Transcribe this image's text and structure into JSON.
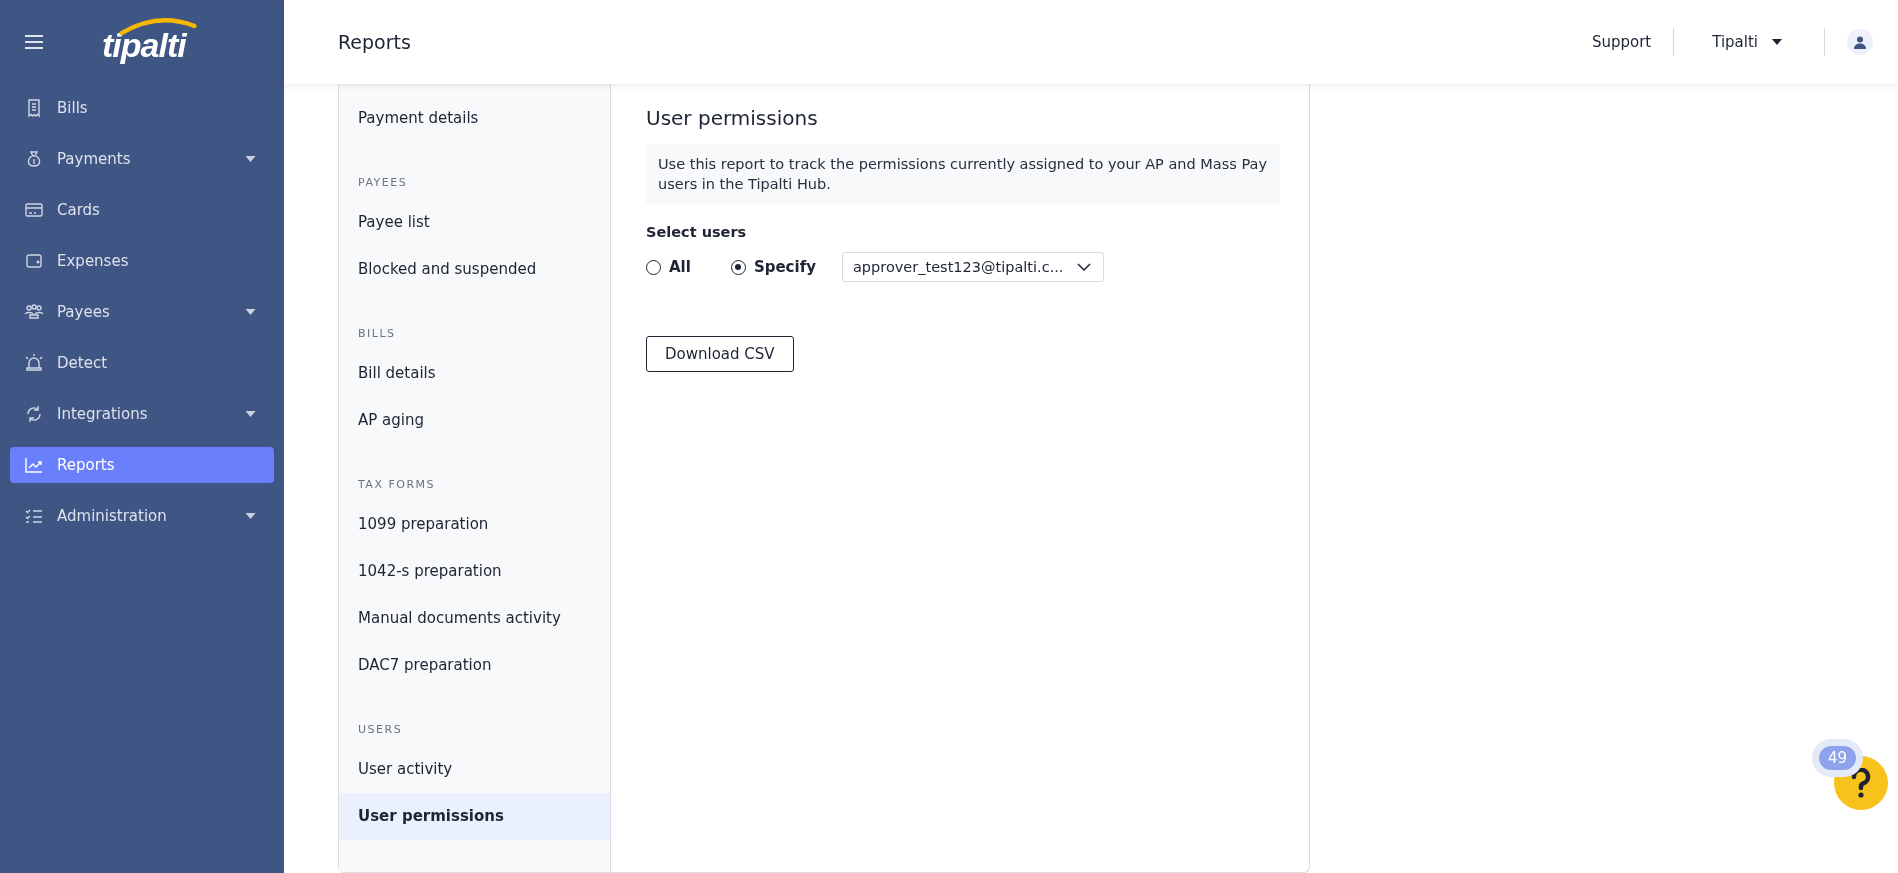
{
  "sidebar": {
    "logo": "tipalti",
    "items": [
      {
        "label": "Bills",
        "has_dropdown": false,
        "selected": false
      },
      {
        "label": "Payments",
        "has_dropdown": true,
        "selected": false
      },
      {
        "label": "Cards",
        "has_dropdown": false,
        "selected": false
      },
      {
        "label": "Expenses",
        "has_dropdown": false,
        "selected": false
      },
      {
        "label": "Payees",
        "has_dropdown": true,
        "selected": false
      },
      {
        "label": "Detect",
        "has_dropdown": false,
        "selected": false
      },
      {
        "label": "Integrations",
        "has_dropdown": true,
        "selected": false
      },
      {
        "label": "Reports",
        "has_dropdown": false,
        "selected": true
      },
      {
        "label": "Administration",
        "has_dropdown": true,
        "selected": false
      }
    ]
  },
  "header": {
    "title": "Reports",
    "support": "Support",
    "account": "Tipalti"
  },
  "report_nav": [
    {
      "items": [
        {
          "label": "Payment details",
          "selected": false
        }
      ]
    },
    {
      "title": "PAYEES",
      "items": [
        {
          "label": "Payee list",
          "selected": false
        },
        {
          "label": "Blocked and suspended",
          "selected": false
        }
      ]
    },
    {
      "title": "BILLS",
      "items": [
        {
          "label": "Bill details",
          "selected": false
        },
        {
          "label": "AP aging",
          "selected": false
        }
      ]
    },
    {
      "title": "TAX FORMS",
      "items": [
        {
          "label": "1099 preparation",
          "selected": false
        },
        {
          "label": "1042-s preparation",
          "selected": false
        },
        {
          "label": "Manual documents activity",
          "selected": false
        },
        {
          "label": "DAC7 preparation",
          "selected": false
        }
      ]
    },
    {
      "title": "USERS",
      "items": [
        {
          "label": "User activity",
          "selected": false
        },
        {
          "label": "User permissions",
          "selected": true
        }
      ]
    }
  ],
  "report": {
    "title": "User permissions",
    "description": "Use this report to track the permissions currently assigned to your AP and Mass Pay users in the Tipalti Hub.",
    "select_label": "Select users",
    "options": [
      {
        "label": "All",
        "selected": false
      },
      {
        "label": "Specify",
        "selected": true
      }
    ],
    "user_select": {
      "value": "approver_test123@tipalti.c..."
    },
    "download_button": "Download CSV"
  },
  "help": {
    "badge": "49"
  }
}
